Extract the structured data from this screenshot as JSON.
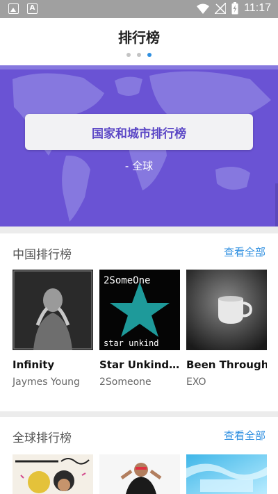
{
  "status_bar": {
    "time": "11:17"
  },
  "header": {
    "title": "排行榜",
    "page_count": 3,
    "active_page": 3
  },
  "banner": {
    "button_label": "国家和城市排行榜",
    "subtitle": "- 全球"
  },
  "sections": [
    {
      "title": "中国排行榜",
      "see_all": "查看全部",
      "albums": [
        {
          "name": "Infinity",
          "artist": "Jaymes Young"
        },
        {
          "name": "Star Unkind…",
          "artist": "2Someone"
        },
        {
          "name": "Been Through",
          "artist": "EXO"
        }
      ]
    },
    {
      "title": "全球排行榜",
      "see_all": "查看全部"
    }
  ],
  "colors": {
    "accent": "#2f8fe0",
    "banner": "#6a53d4",
    "star": "#1e9a9a"
  }
}
